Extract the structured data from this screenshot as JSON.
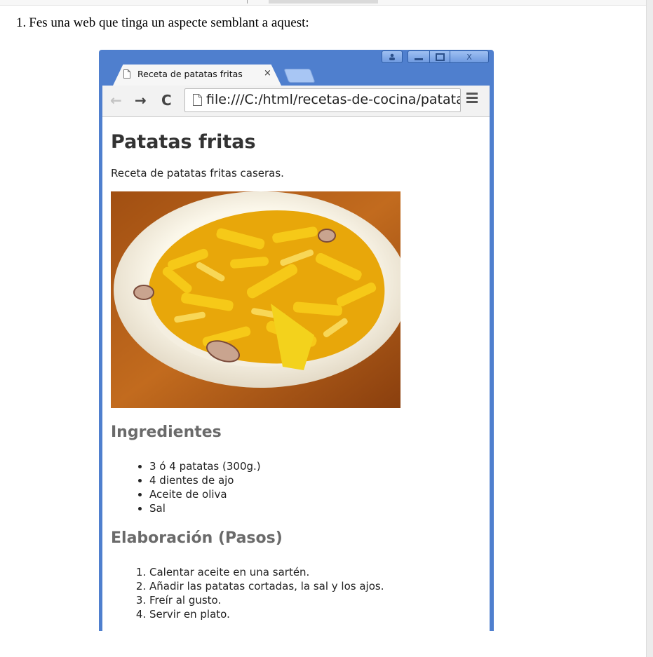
{
  "instruction": {
    "number": "1.",
    "text": "Fes una web que tinga un aspecte semblant a aquest:"
  },
  "browser": {
    "tab_title": "Receta de patatas fritas",
    "tab_close": "×",
    "nav": {
      "back": "←",
      "forward": "→",
      "reload": "C"
    },
    "url": "file:///C:/html/recetas-de-cocina/patatas-fritas.html",
    "window_controls": [
      "user",
      "minimize",
      "maximize",
      "close"
    ],
    "close_label": "X",
    "chrome_color": "#4f7fce"
  },
  "page": {
    "title": "Patatas fritas",
    "description": "Receta de patatas fritas caseras.",
    "image": "plate of fried potatoes with garlic",
    "ingredients_heading": "Ingredientes",
    "ingredients": [
      "3 ó 4 patatas (300g.)",
      "4 dientes de ajo",
      "Aceite de oliva",
      "Sal"
    ],
    "steps_heading": "Elaboración (Pasos)",
    "steps": [
      "Calentar aceite en una sartén.",
      "Añadir las patatas cortadas, la sal y los ajos.",
      "Freír al gusto.",
      "Servir en plato."
    ]
  }
}
